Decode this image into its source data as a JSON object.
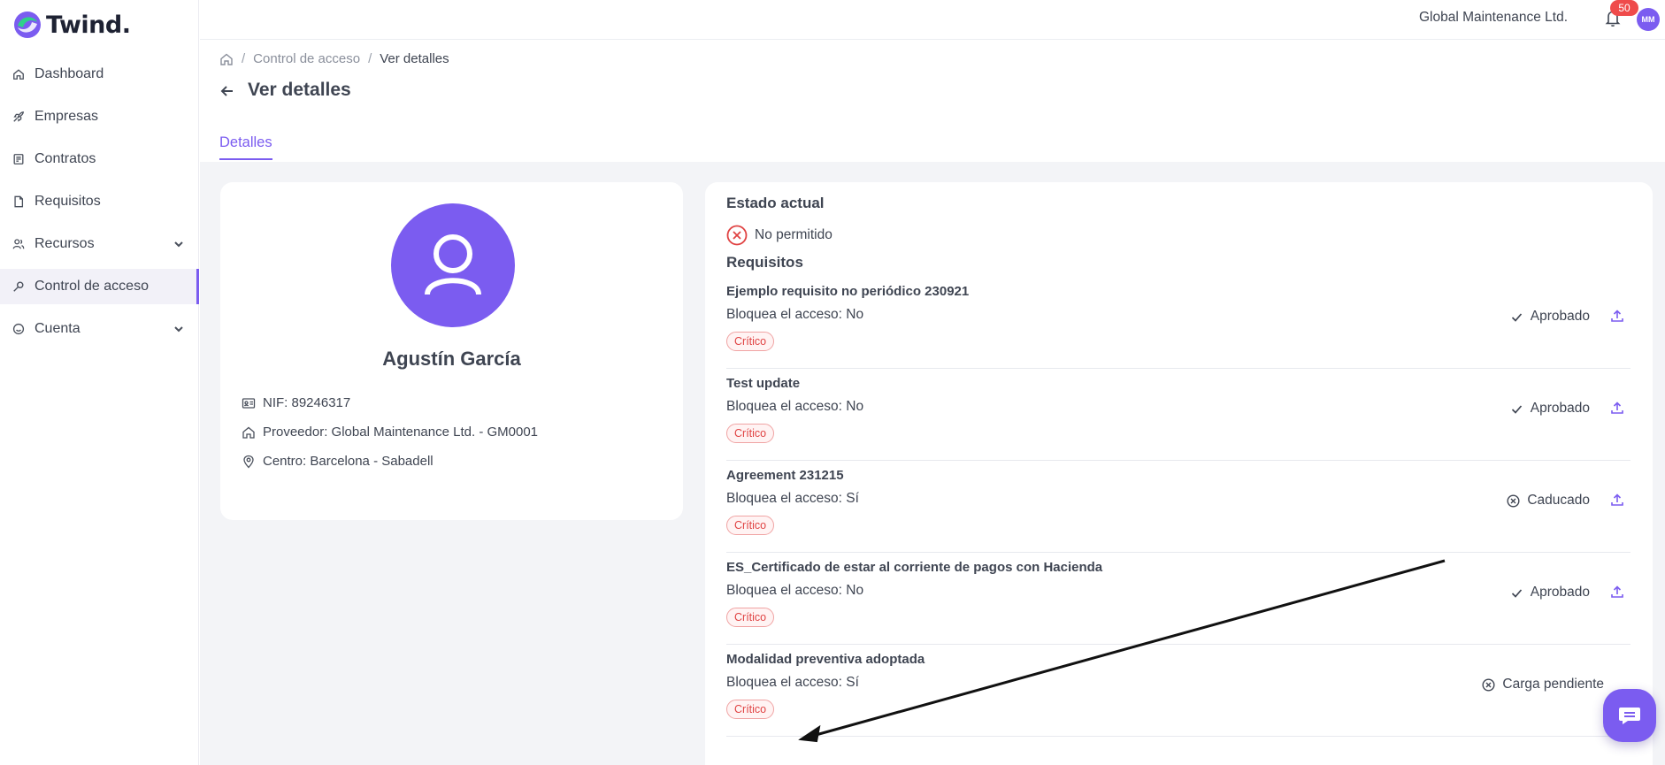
{
  "app": {
    "logo_text": "Twind."
  },
  "sidebar": {
    "items": [
      {
        "label": "Dashboard",
        "icon": "home-icon"
      },
      {
        "label": "Empresas",
        "icon": "rocket-icon"
      },
      {
        "label": "Contratos",
        "icon": "contract-icon"
      },
      {
        "label": "Requisitos",
        "icon": "file-icon"
      },
      {
        "label": "Recursos",
        "icon": "users-icon",
        "expandable": true
      },
      {
        "label": "Control de acceso",
        "icon": "key-icon",
        "active": true
      },
      {
        "label": "Cuenta",
        "icon": "smile-icon",
        "expandable": true
      }
    ]
  },
  "topbar": {
    "company": "Global Maintenance Ltd.",
    "notifications": "50",
    "user_initials": "MM"
  },
  "breadcrumb": {
    "items": [
      "Control de acceso",
      "Ver detalles"
    ]
  },
  "page": {
    "title": "Ver detalles",
    "tab": "Detalles"
  },
  "person": {
    "name": "Agustín García",
    "nif": "NIF: 89246317",
    "proveedor": "Proveedor: Global Maintenance Ltd. - GM0001",
    "centro": "Centro: Barcelona - Sabadell"
  },
  "estado": {
    "title": "Estado actual",
    "value": "No permitido"
  },
  "requisitos": {
    "title": "Requisitos",
    "items": [
      {
        "name": "Ejemplo requisito no periódico 230921",
        "block": "Bloquea el acceso: No",
        "tag": "Crítico",
        "status": "Aprobado"
      },
      {
        "name": "Test update",
        "block": "Bloquea el acceso: No",
        "tag": "Crítico",
        "status": "Aprobado"
      },
      {
        "name": "Agreement 231215",
        "block": "Bloquea el acceso: Sí",
        "tag": "Crítico",
        "status": "Caducado"
      },
      {
        "name": "ES_Certificado de estar al corriente de pagos con Hacienda",
        "block": "Bloquea el acceso: No",
        "tag": "Crítico",
        "status": "Aprobado"
      },
      {
        "name": "Modalidad preventiva adoptada",
        "block": "Bloquea el acceso: Sí",
        "tag": "Crítico",
        "status": "Carga pendiente"
      }
    ]
  },
  "colors": {
    "accent": "#7b5cf0",
    "danger": "#e04343",
    "badge": "#ef4b4b"
  }
}
